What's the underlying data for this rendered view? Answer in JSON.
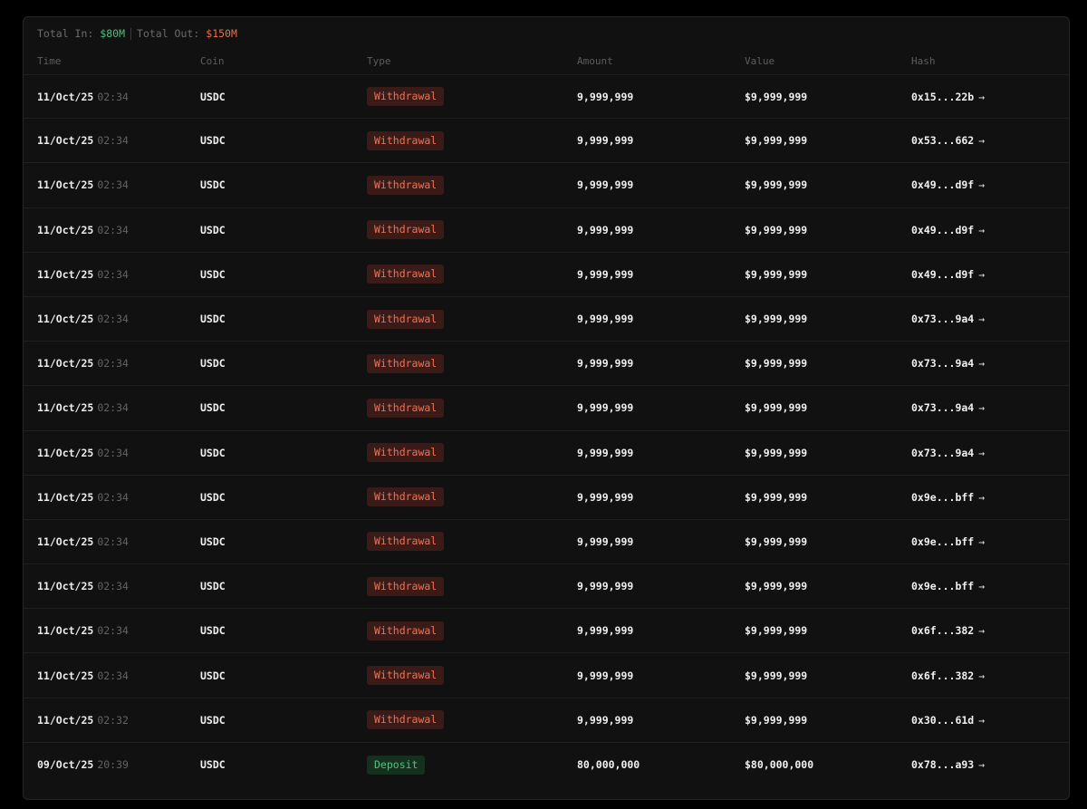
{
  "summary": {
    "total_in_label": "Total In:",
    "total_in_value": "$80M",
    "total_out_label": "Total Out:",
    "total_out_value": "$150M"
  },
  "columns": {
    "time": "Time",
    "coin": "Coin",
    "type": "Type",
    "amount": "Amount",
    "value": "Value",
    "hash": "Hash"
  },
  "colors": {
    "in": "#4fc07a",
    "out": "#ec6f48",
    "withdrawal_bg": "#3a1b17",
    "deposit_bg": "#15301f"
  },
  "rows": [
    {
      "date": "11/Oct/25",
      "time": "02:34",
      "coin": "USDC",
      "type": "Withdrawal",
      "kind": "withdrawal",
      "amount": "9,999,999",
      "value": "$9,999,999",
      "hash": "0x15...22b"
    },
    {
      "date": "11/Oct/25",
      "time": "02:34",
      "coin": "USDC",
      "type": "Withdrawal",
      "kind": "withdrawal",
      "amount": "9,999,999",
      "value": "$9,999,999",
      "hash": "0x53...662"
    },
    {
      "date": "11/Oct/25",
      "time": "02:34",
      "coin": "USDC",
      "type": "Withdrawal",
      "kind": "withdrawal",
      "amount": "9,999,999",
      "value": "$9,999,999",
      "hash": "0x49...d9f"
    },
    {
      "date": "11/Oct/25",
      "time": "02:34",
      "coin": "USDC",
      "type": "Withdrawal",
      "kind": "withdrawal",
      "amount": "9,999,999",
      "value": "$9,999,999",
      "hash": "0x49...d9f"
    },
    {
      "date": "11/Oct/25",
      "time": "02:34",
      "coin": "USDC",
      "type": "Withdrawal",
      "kind": "withdrawal",
      "amount": "9,999,999",
      "value": "$9,999,999",
      "hash": "0x49...d9f"
    },
    {
      "date": "11/Oct/25",
      "time": "02:34",
      "coin": "USDC",
      "type": "Withdrawal",
      "kind": "withdrawal",
      "amount": "9,999,999",
      "value": "$9,999,999",
      "hash": "0x73...9a4"
    },
    {
      "date": "11/Oct/25",
      "time": "02:34",
      "coin": "USDC",
      "type": "Withdrawal",
      "kind": "withdrawal",
      "amount": "9,999,999",
      "value": "$9,999,999",
      "hash": "0x73...9a4"
    },
    {
      "date": "11/Oct/25",
      "time": "02:34",
      "coin": "USDC",
      "type": "Withdrawal",
      "kind": "withdrawal",
      "amount": "9,999,999",
      "value": "$9,999,999",
      "hash": "0x73...9a4"
    },
    {
      "date": "11/Oct/25",
      "time": "02:34",
      "coin": "USDC",
      "type": "Withdrawal",
      "kind": "withdrawal",
      "amount": "9,999,999",
      "value": "$9,999,999",
      "hash": "0x73...9a4"
    },
    {
      "date": "11/Oct/25",
      "time": "02:34",
      "coin": "USDC",
      "type": "Withdrawal",
      "kind": "withdrawal",
      "amount": "9,999,999",
      "value": "$9,999,999",
      "hash": "0x9e...bff"
    },
    {
      "date": "11/Oct/25",
      "time": "02:34",
      "coin": "USDC",
      "type": "Withdrawal",
      "kind": "withdrawal",
      "amount": "9,999,999",
      "value": "$9,999,999",
      "hash": "0x9e...bff"
    },
    {
      "date": "11/Oct/25",
      "time": "02:34",
      "coin": "USDC",
      "type": "Withdrawal",
      "kind": "withdrawal",
      "amount": "9,999,999",
      "value": "$9,999,999",
      "hash": "0x9e...bff"
    },
    {
      "date": "11/Oct/25",
      "time": "02:34",
      "coin": "USDC",
      "type": "Withdrawal",
      "kind": "withdrawal",
      "amount": "9,999,999",
      "value": "$9,999,999",
      "hash": "0x6f...382"
    },
    {
      "date": "11/Oct/25",
      "time": "02:34",
      "coin": "USDC",
      "type": "Withdrawal",
      "kind": "withdrawal",
      "amount": "9,999,999",
      "value": "$9,999,999",
      "hash": "0x6f...382"
    },
    {
      "date": "11/Oct/25",
      "time": "02:32",
      "coin": "USDC",
      "type": "Withdrawal",
      "kind": "withdrawal",
      "amount": "9,999,999",
      "value": "$9,999,999",
      "hash": "0x30...61d"
    },
    {
      "date": "09/Oct/25",
      "time": "20:39",
      "coin": "USDC",
      "type": "Deposit",
      "kind": "deposit",
      "amount": "80,000,000",
      "value": "$80,000,000",
      "hash": "0x78...a93"
    }
  ],
  "icons": {
    "hash_link": "arrow-right-icon",
    "arrow_glyph": "→"
  }
}
